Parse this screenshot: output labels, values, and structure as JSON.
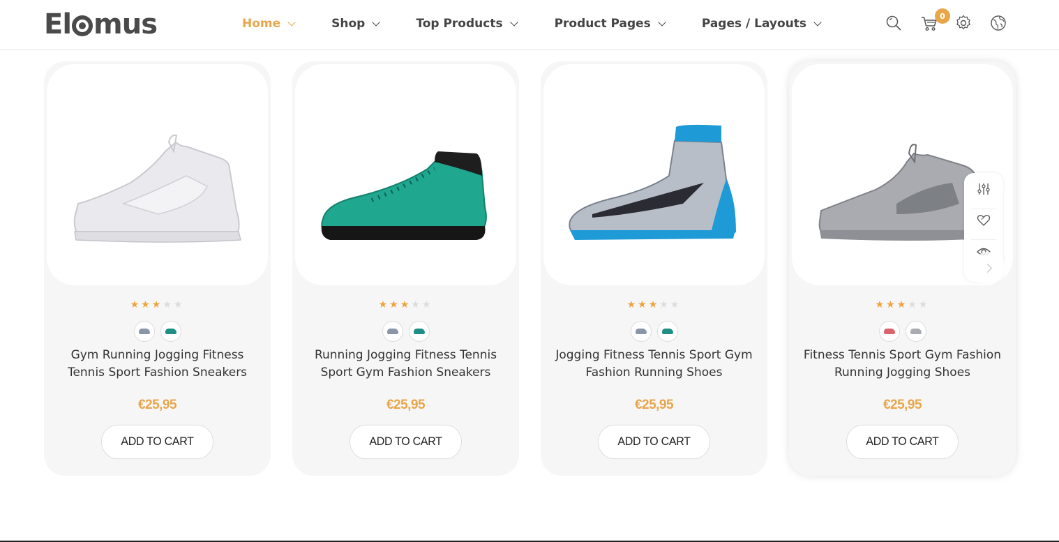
{
  "header": {
    "logo_text_left": "El",
    "logo_text_right": "mus",
    "logo_full": "Elomus",
    "nav": [
      {
        "label": "Home",
        "active": true
      },
      {
        "label": "Shop",
        "active": false
      },
      {
        "label": "Top Products",
        "active": false
      },
      {
        "label": "Product Pages",
        "active": false
      },
      {
        "label": "Pages / Layouts",
        "active": false
      }
    ],
    "icons": [
      "search-icon",
      "cart-icon",
      "gear-icon",
      "globe-icon"
    ],
    "cart_count": "0",
    "accent_color": "#e8a64b"
  },
  "products": [
    {
      "title": "Gym Running Jogging Fitness Tennis Sport Fashion Sneakers",
      "price": "€25,95",
      "rating": 3,
      "rating_max": 5,
      "button": "ADD TO CART",
      "shoe_color": "#e9e9ee",
      "swatches": [
        "#8a96a8",
        "#1f8f86"
      ]
    },
    {
      "title": "Running Jogging Fitness Tennis Sport Gym Fashion Sneakers",
      "price": "€25,95",
      "rating": 3,
      "rating_max": 5,
      "button": "ADD TO CART",
      "shoe_color": "#1fa88f",
      "swatches": [
        "#8a96a8",
        "#1f8f86"
      ]
    },
    {
      "title": "Jogging Fitness Tennis Sport Gym Fashion Running Shoes",
      "price": "€25,95",
      "rating": 3,
      "rating_max": 5,
      "button": "ADD TO CART",
      "shoe_color": "#9aa3b0",
      "swatches": [
        "#8a96a8",
        "#1f8f86"
      ]
    },
    {
      "title": "Fitness Tennis Sport Gym Fashion Running Jogging Shoes",
      "price": "€25,95",
      "rating": 3,
      "rating_max": 5,
      "button": "ADD TO CART",
      "shoe_color": "#a9abb0",
      "swatches": [
        "#d9646b",
        "#a9abb0"
      ]
    }
  ],
  "quick_actions": [
    "compare-icon",
    "wishlist-heart-icon",
    "quickview-eye-icon"
  ],
  "carousel": {
    "next_icon": "chevron-right-icon"
  }
}
